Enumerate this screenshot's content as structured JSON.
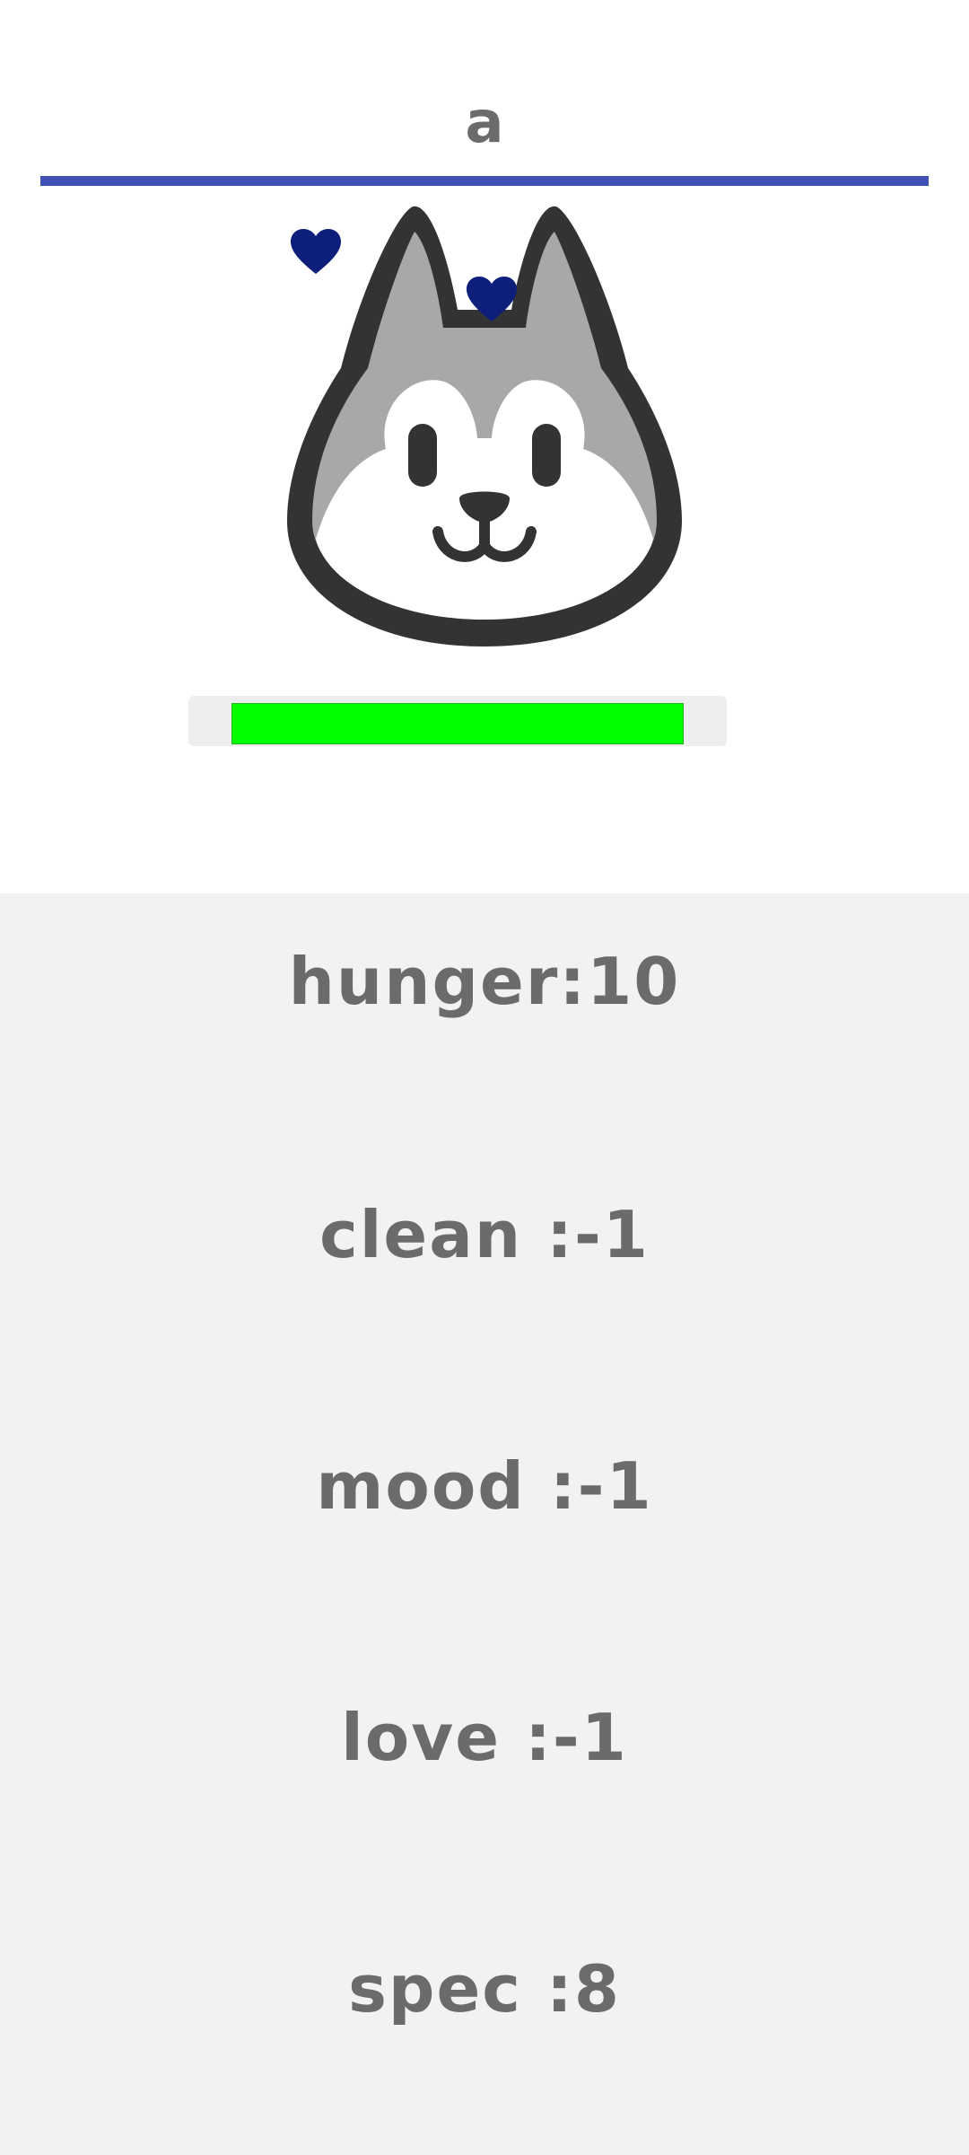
{
  "pet": {
    "name": "a",
    "image": "husky-face-icon",
    "hearts": [
      "heart-icon",
      "heart-icon"
    ]
  },
  "health": {
    "level": 1.0
  },
  "stats": [
    {
      "label": "hunger:10"
    },
    {
      "label": "clean :-1"
    },
    {
      "label": "mood :-1"
    },
    {
      "label": "love :-1"
    },
    {
      "label": "spec :8"
    }
  ],
  "colors": {
    "accent": "#3f51b5",
    "heart": "#0d1f7a",
    "health": "#00ff00",
    "text": "#6b6b6b",
    "stats_background": "#f2f2f2"
  }
}
